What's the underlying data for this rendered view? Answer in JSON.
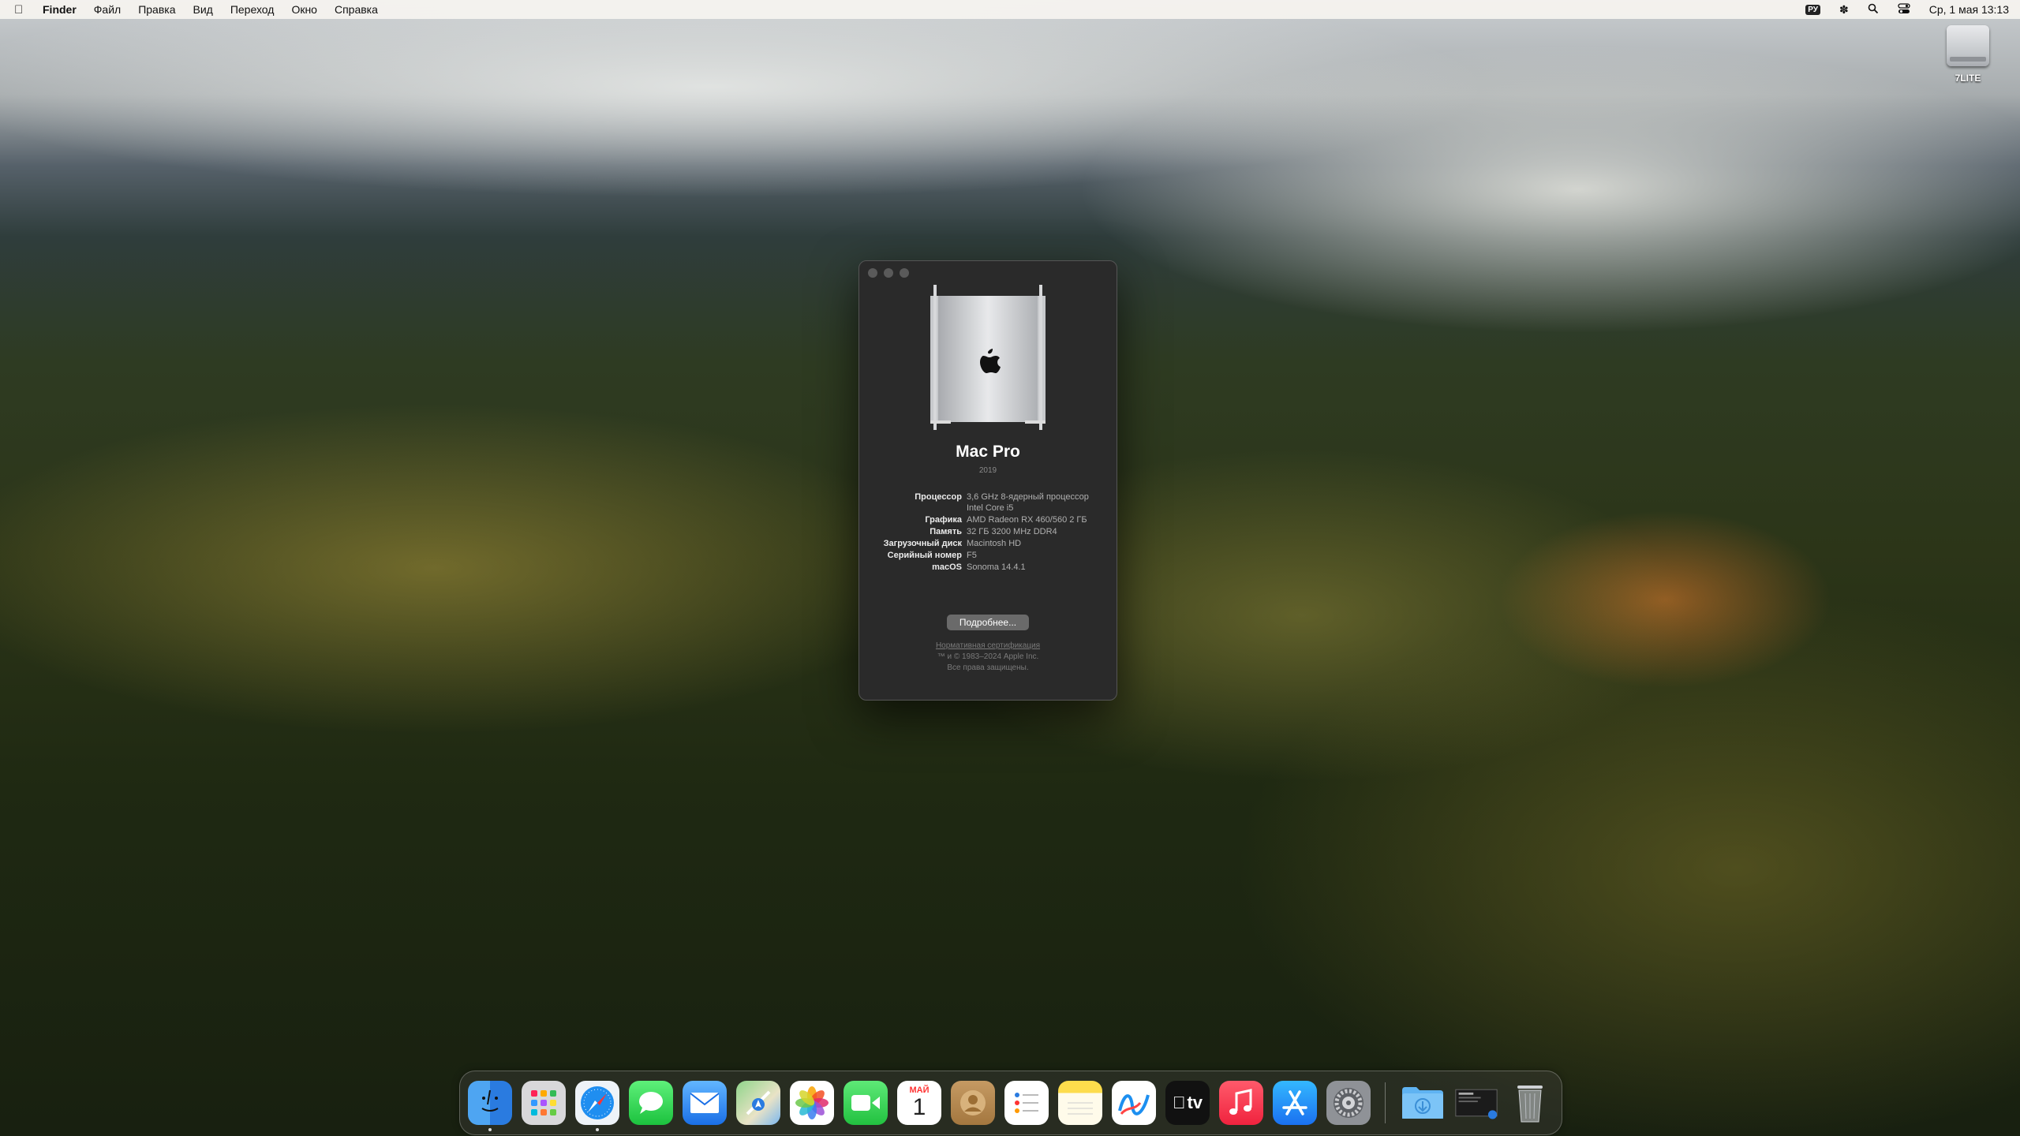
{
  "menubar": {
    "app": "Finder",
    "items": [
      "Файл",
      "Правка",
      "Вид",
      "Переход",
      "Окно",
      "Справка"
    ],
    "input_source": "РУ",
    "datetime": "Ср, 1 мая  13:13"
  },
  "desktop": {
    "volume_label": "7LITE"
  },
  "about": {
    "model": "Mac Pro",
    "year": "2019",
    "specs": [
      {
        "key": "Процессор",
        "value": "3,6 GHz 8-ядерный процессор Intel Core i5"
      },
      {
        "key": "Графика",
        "value": "AMD Radeon RX 460/560 2 ГБ"
      },
      {
        "key": "Память",
        "value": "32 ГБ 3200 MHz DDR4"
      },
      {
        "key": "Загрузочный диск",
        "value": "Macintosh HD"
      },
      {
        "key": "Серийный номер",
        "value": "F5"
      },
      {
        "key": "macOS",
        "value": "Sonoma 14.4.1"
      }
    ],
    "more_button": "Подробнее...",
    "regulatory_link": "Нормативная сертификация",
    "copyright": "™ и © 1983–2024 Apple Inc.",
    "rights": "Все права защищены."
  },
  "dock": {
    "calendar_month": "МАЙ",
    "calendar_day": "1",
    "tv_label": "tv",
    "items": [
      "finder",
      "launchpad",
      "safari",
      "messages",
      "mail",
      "maps",
      "photos",
      "facetime",
      "calendar",
      "contacts",
      "reminders",
      "notes",
      "freeform",
      "tv",
      "music",
      "app-store",
      "system-settings",
      "downloads",
      "screenshot",
      "trash"
    ]
  }
}
